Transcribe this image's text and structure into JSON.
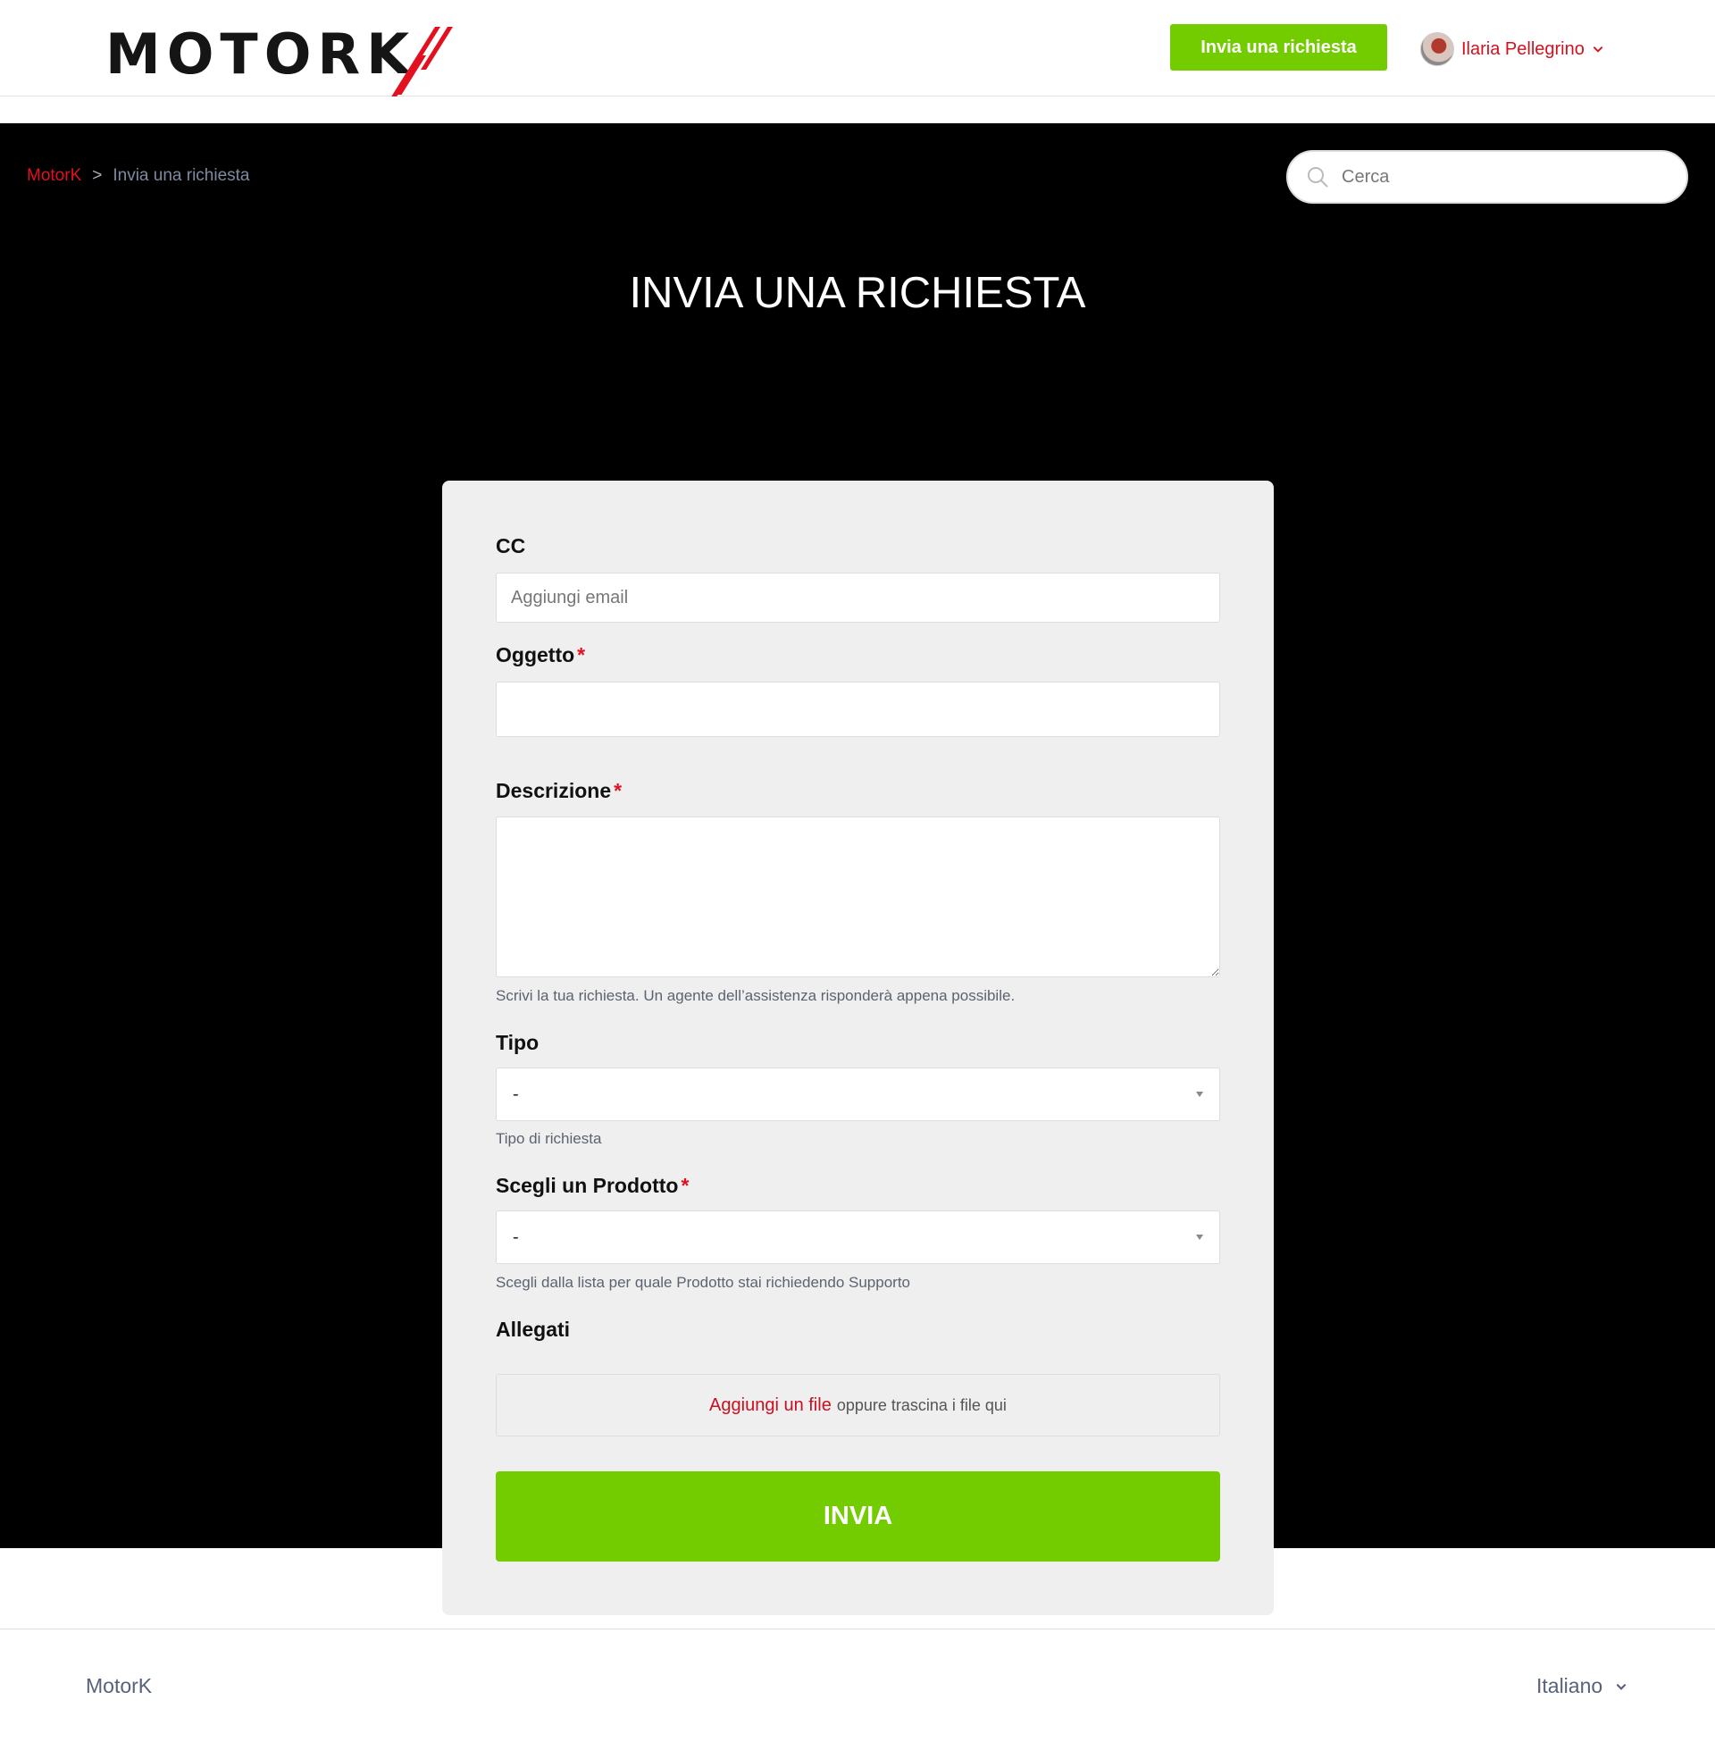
{
  "header": {
    "logo_text": "MOTORK",
    "request_button": "Invia una richiesta",
    "user_name": "Ilaria Pellegrino"
  },
  "breadcrumb": {
    "home": "MotorK",
    "separator": ">",
    "current": "Invia una richiesta"
  },
  "search": {
    "placeholder": "Cerca"
  },
  "page_title": "INVIA UNA RICHIESTA",
  "form": {
    "cc": {
      "label": "CC",
      "placeholder": "Aggiungi email"
    },
    "subject": {
      "label": "Oggetto",
      "required_mark": "*",
      "value": ""
    },
    "description": {
      "label": "Descrizione",
      "required_mark": "*",
      "hint": "Scrivi la tua richiesta. Un agente dell’assistenza risponderà appena possibile."
    },
    "type": {
      "label": "Tipo",
      "selected": "-",
      "hint": "Tipo di richiesta"
    },
    "product": {
      "label": "Scegli un Prodotto",
      "required_mark": "*",
      "selected": "-",
      "hint": "Scegli dalla lista per quale Prodotto stai richiedendo Supporto"
    },
    "attachments": {
      "label": "Allegati",
      "add_link": "Aggiungi un file",
      "drop_text": "oppure trascina i file qui"
    },
    "submit_label": "INVIA"
  },
  "footer": {
    "brand": "MotorK",
    "language": "Italiano"
  },
  "colors": {
    "accent_green": "#73cc00",
    "brand_red": "#e3101f",
    "hero_background": "#000000",
    "card_background": "#efefef"
  },
  "icons": [
    "search-icon",
    "chevron-down-icon",
    "avatar",
    "dropdown-caret-icon"
  ]
}
